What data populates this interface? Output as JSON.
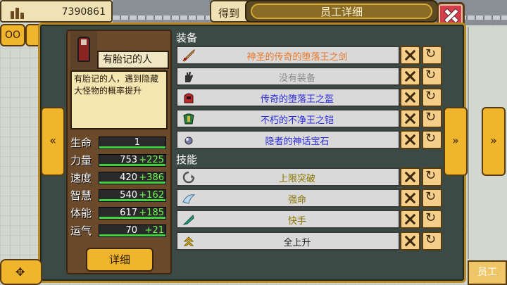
{
  "hud": {
    "money": "7390861",
    "got_label": "得到"
  },
  "modal": {
    "title": "员工详细"
  },
  "employee": {
    "name": "有胎记的人",
    "description": "有胎记的人，遇到隐藏大怪物的概率提升",
    "stats": [
      {
        "label": "生命",
        "value": "1",
        "bonus": ""
      },
      {
        "label": "力量",
        "value": "753",
        "bonus": "+225"
      },
      {
        "label": "速度",
        "value": "420",
        "bonus": "+386"
      },
      {
        "label": "智慧",
        "value": "540",
        "bonus": "+162"
      },
      {
        "label": "体能",
        "value": "617",
        "bonus": "+185"
      },
      {
        "label": "运气",
        "value": "70",
        "bonus": "+21"
      }
    ],
    "detail_button": "详细"
  },
  "equipment": {
    "header": "装备",
    "items": [
      {
        "name": "神圣的传奇的堕落王之剑",
        "color": "#e9782a",
        "icon": "sword-icon"
      },
      {
        "name": "没有装备",
        "color": "#8c8c8c",
        "icon": "hand-icon"
      },
      {
        "name": "传奇的堕落王之盔",
        "color": "#2a2adf",
        "icon": "helmet-icon"
      },
      {
        "name": "不朽的不净王之铠",
        "color": "#2a2adf",
        "icon": "armor-icon"
      },
      {
        "name": "隐者的神话宝石",
        "color": "#2a2adf",
        "icon": "gem-icon"
      }
    ]
  },
  "skills": {
    "header": "技能",
    "items": [
      {
        "name": "上限突破",
        "color": "#8a7600",
        "icon": "break-limit-icon"
      },
      {
        "name": "强命",
        "color": "#8a7600",
        "icon": "wing-icon"
      },
      {
        "name": "快手",
        "color": "#8a7600",
        "icon": "feather-icon"
      },
      {
        "name": "全上升",
        "color": "#1f1f1f",
        "icon": "up-arrows-icon"
      }
    ]
  },
  "bottom": {
    "right_label": "员工"
  }
}
